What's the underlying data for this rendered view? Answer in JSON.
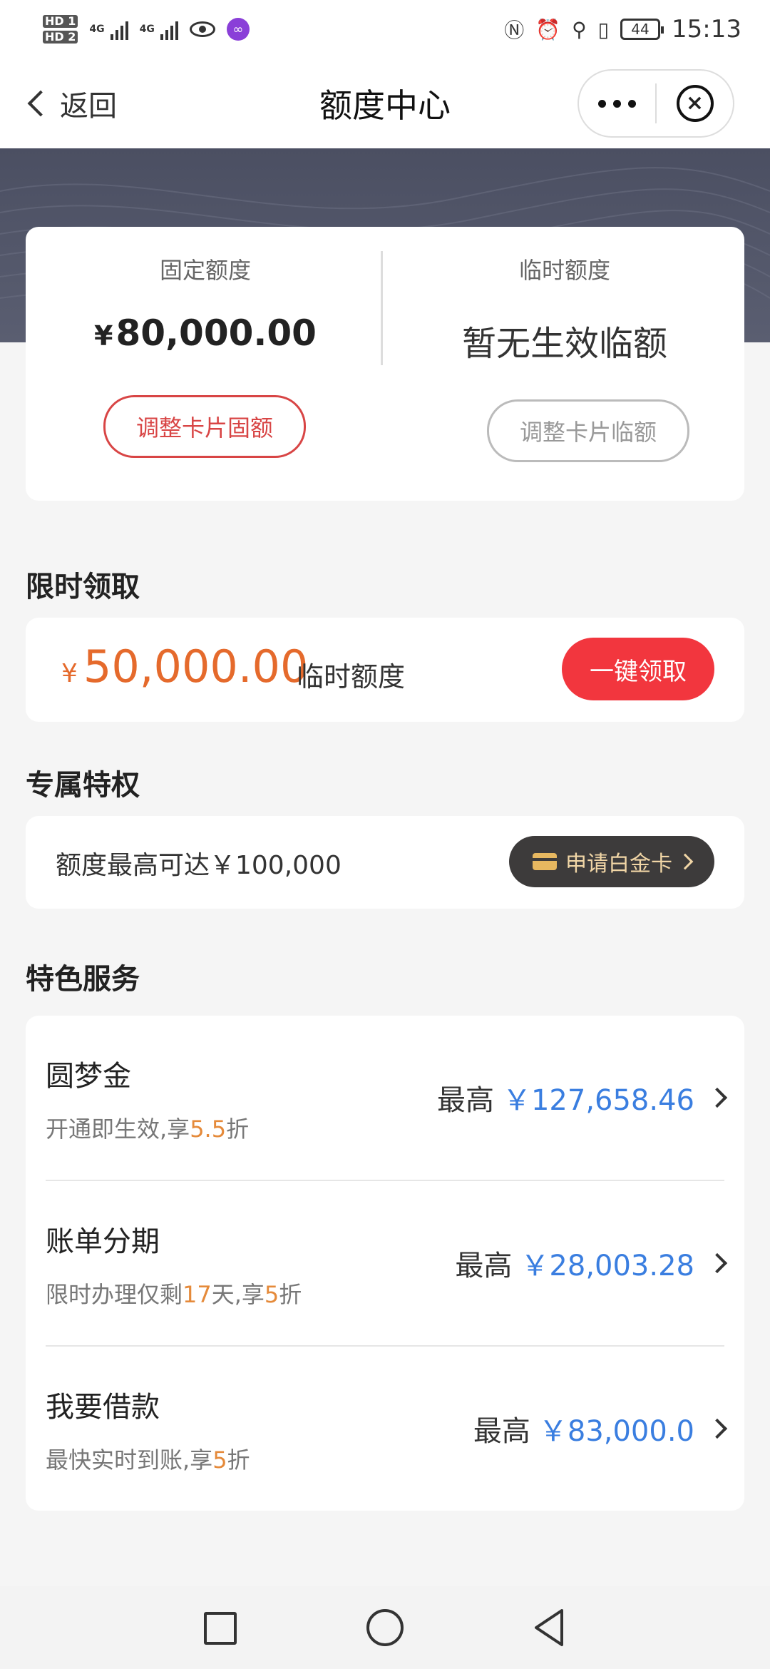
{
  "status_bar": {
    "hd1": "HD 1",
    "hd2": "HD 2",
    "net1": "4G",
    "net2": "4G",
    "battery": "44",
    "time": "15:13"
  },
  "nav": {
    "back_label": "返回",
    "title": "额度中心"
  },
  "quota": {
    "fixed_label": "固定额度",
    "fixed_currency": "¥",
    "fixed_value": "80,000.00",
    "fixed_button": "调整卡片固额",
    "temp_label": "临时额度",
    "temp_value": "暂无生效临额",
    "temp_button": "调整卡片临额"
  },
  "limited": {
    "section_title": "限时领取",
    "currency": "¥",
    "amount": "50,000.00",
    "tag": "临时额度",
    "button": "一键领取"
  },
  "privilege": {
    "section_title": "专属特权",
    "text": "额度最高可达￥100,000",
    "button": "申请白金卡"
  },
  "services": {
    "section_title": "特色服务",
    "items": [
      {
        "title": "圆梦金",
        "sub_pre": "开通即生效,享",
        "sub_hl": "5.5",
        "sub_post": "折",
        "sub_pre2": "",
        "sub_hl2": "",
        "max_label": "最高",
        "amount": "￥127,658.46"
      },
      {
        "title": "账单分期",
        "sub_pre": "限时办理仅剩",
        "sub_hl": "17",
        "sub_post": "天,享",
        "sub_hl2": "5",
        "sub_post2": "折",
        "max_label": "最高",
        "amount": "￥28,003.28"
      },
      {
        "title": "我要借款",
        "sub_pre": "最快实时到账,享",
        "sub_hl": "5",
        "sub_post": "折",
        "sub_hl2": "",
        "sub_post2": "",
        "max_label": "最高",
        "amount": "￥83,000.0"
      }
    ]
  },
  "colors": {
    "accent_red": "#f2363e",
    "amount_orange": "#e56a2c",
    "amount_blue": "#3a7ee0",
    "hero_bg": "#4b4f62"
  }
}
